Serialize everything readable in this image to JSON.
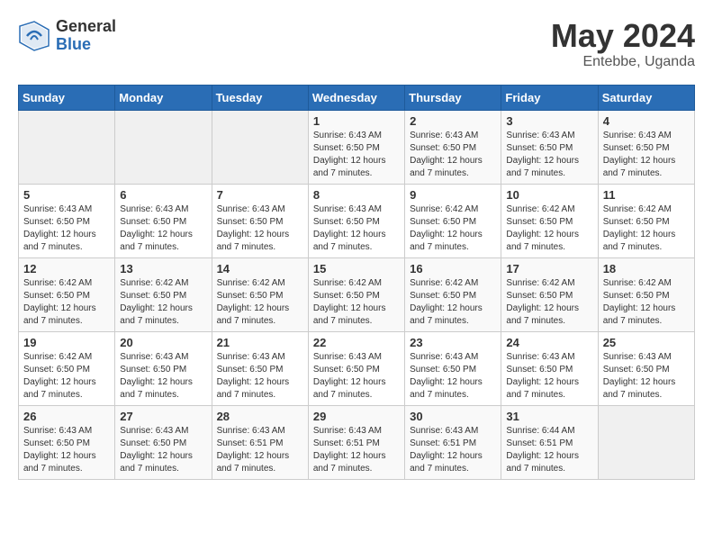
{
  "header": {
    "logo_general": "General",
    "logo_blue": "Blue",
    "month_year": "May 2024",
    "location": "Entebbe, Uganda"
  },
  "weekdays": [
    "Sunday",
    "Monday",
    "Tuesday",
    "Wednesday",
    "Thursday",
    "Friday",
    "Saturday"
  ],
  "weeks": [
    [
      {
        "day": "",
        "empty": true
      },
      {
        "day": "",
        "empty": true
      },
      {
        "day": "",
        "empty": true
      },
      {
        "day": "1",
        "sunrise": "6:43 AM",
        "sunset": "6:50 PM",
        "daylight": "12 hours and 7 minutes."
      },
      {
        "day": "2",
        "sunrise": "6:43 AM",
        "sunset": "6:50 PM",
        "daylight": "12 hours and 7 minutes."
      },
      {
        "day": "3",
        "sunrise": "6:43 AM",
        "sunset": "6:50 PM",
        "daylight": "12 hours and 7 minutes."
      },
      {
        "day": "4",
        "sunrise": "6:43 AM",
        "sunset": "6:50 PM",
        "daylight": "12 hours and 7 minutes."
      }
    ],
    [
      {
        "day": "5",
        "sunrise": "6:43 AM",
        "sunset": "6:50 PM",
        "daylight": "12 hours and 7 minutes."
      },
      {
        "day": "6",
        "sunrise": "6:43 AM",
        "sunset": "6:50 PM",
        "daylight": "12 hours and 7 minutes."
      },
      {
        "day": "7",
        "sunrise": "6:43 AM",
        "sunset": "6:50 PM",
        "daylight": "12 hours and 7 minutes."
      },
      {
        "day": "8",
        "sunrise": "6:43 AM",
        "sunset": "6:50 PM",
        "daylight": "12 hours and 7 minutes."
      },
      {
        "day": "9",
        "sunrise": "6:42 AM",
        "sunset": "6:50 PM",
        "daylight": "12 hours and 7 minutes."
      },
      {
        "day": "10",
        "sunrise": "6:42 AM",
        "sunset": "6:50 PM",
        "daylight": "12 hours and 7 minutes."
      },
      {
        "day": "11",
        "sunrise": "6:42 AM",
        "sunset": "6:50 PM",
        "daylight": "12 hours and 7 minutes."
      }
    ],
    [
      {
        "day": "12",
        "sunrise": "6:42 AM",
        "sunset": "6:50 PM",
        "daylight": "12 hours and 7 minutes."
      },
      {
        "day": "13",
        "sunrise": "6:42 AM",
        "sunset": "6:50 PM",
        "daylight": "12 hours and 7 minutes."
      },
      {
        "day": "14",
        "sunrise": "6:42 AM",
        "sunset": "6:50 PM",
        "daylight": "12 hours and 7 minutes."
      },
      {
        "day": "15",
        "sunrise": "6:42 AM",
        "sunset": "6:50 PM",
        "daylight": "12 hours and 7 minutes."
      },
      {
        "day": "16",
        "sunrise": "6:42 AM",
        "sunset": "6:50 PM",
        "daylight": "12 hours and 7 minutes."
      },
      {
        "day": "17",
        "sunrise": "6:42 AM",
        "sunset": "6:50 PM",
        "daylight": "12 hours and 7 minutes."
      },
      {
        "day": "18",
        "sunrise": "6:42 AM",
        "sunset": "6:50 PM",
        "daylight": "12 hours and 7 minutes."
      }
    ],
    [
      {
        "day": "19",
        "sunrise": "6:42 AM",
        "sunset": "6:50 PM",
        "daylight": "12 hours and 7 minutes."
      },
      {
        "day": "20",
        "sunrise": "6:43 AM",
        "sunset": "6:50 PM",
        "daylight": "12 hours and 7 minutes."
      },
      {
        "day": "21",
        "sunrise": "6:43 AM",
        "sunset": "6:50 PM",
        "daylight": "12 hours and 7 minutes."
      },
      {
        "day": "22",
        "sunrise": "6:43 AM",
        "sunset": "6:50 PM",
        "daylight": "12 hours and 7 minutes."
      },
      {
        "day": "23",
        "sunrise": "6:43 AM",
        "sunset": "6:50 PM",
        "daylight": "12 hours and 7 minutes."
      },
      {
        "day": "24",
        "sunrise": "6:43 AM",
        "sunset": "6:50 PM",
        "daylight": "12 hours and 7 minutes."
      },
      {
        "day": "25",
        "sunrise": "6:43 AM",
        "sunset": "6:50 PM",
        "daylight": "12 hours and 7 minutes."
      }
    ],
    [
      {
        "day": "26",
        "sunrise": "6:43 AM",
        "sunset": "6:50 PM",
        "daylight": "12 hours and 7 minutes."
      },
      {
        "day": "27",
        "sunrise": "6:43 AM",
        "sunset": "6:50 PM",
        "daylight": "12 hours and 7 minutes."
      },
      {
        "day": "28",
        "sunrise": "6:43 AM",
        "sunset": "6:51 PM",
        "daylight": "12 hours and 7 minutes."
      },
      {
        "day": "29",
        "sunrise": "6:43 AM",
        "sunset": "6:51 PM",
        "daylight": "12 hours and 7 minutes."
      },
      {
        "day": "30",
        "sunrise": "6:43 AM",
        "sunset": "6:51 PM",
        "daylight": "12 hours and 7 minutes."
      },
      {
        "day": "31",
        "sunrise": "6:44 AM",
        "sunset": "6:51 PM",
        "daylight": "12 hours and 7 minutes."
      },
      {
        "day": "",
        "empty": true
      }
    ]
  ],
  "labels": {
    "sunrise_prefix": "Sunrise: ",
    "sunset_prefix": "Sunset: ",
    "daylight_prefix": "Daylight: "
  }
}
